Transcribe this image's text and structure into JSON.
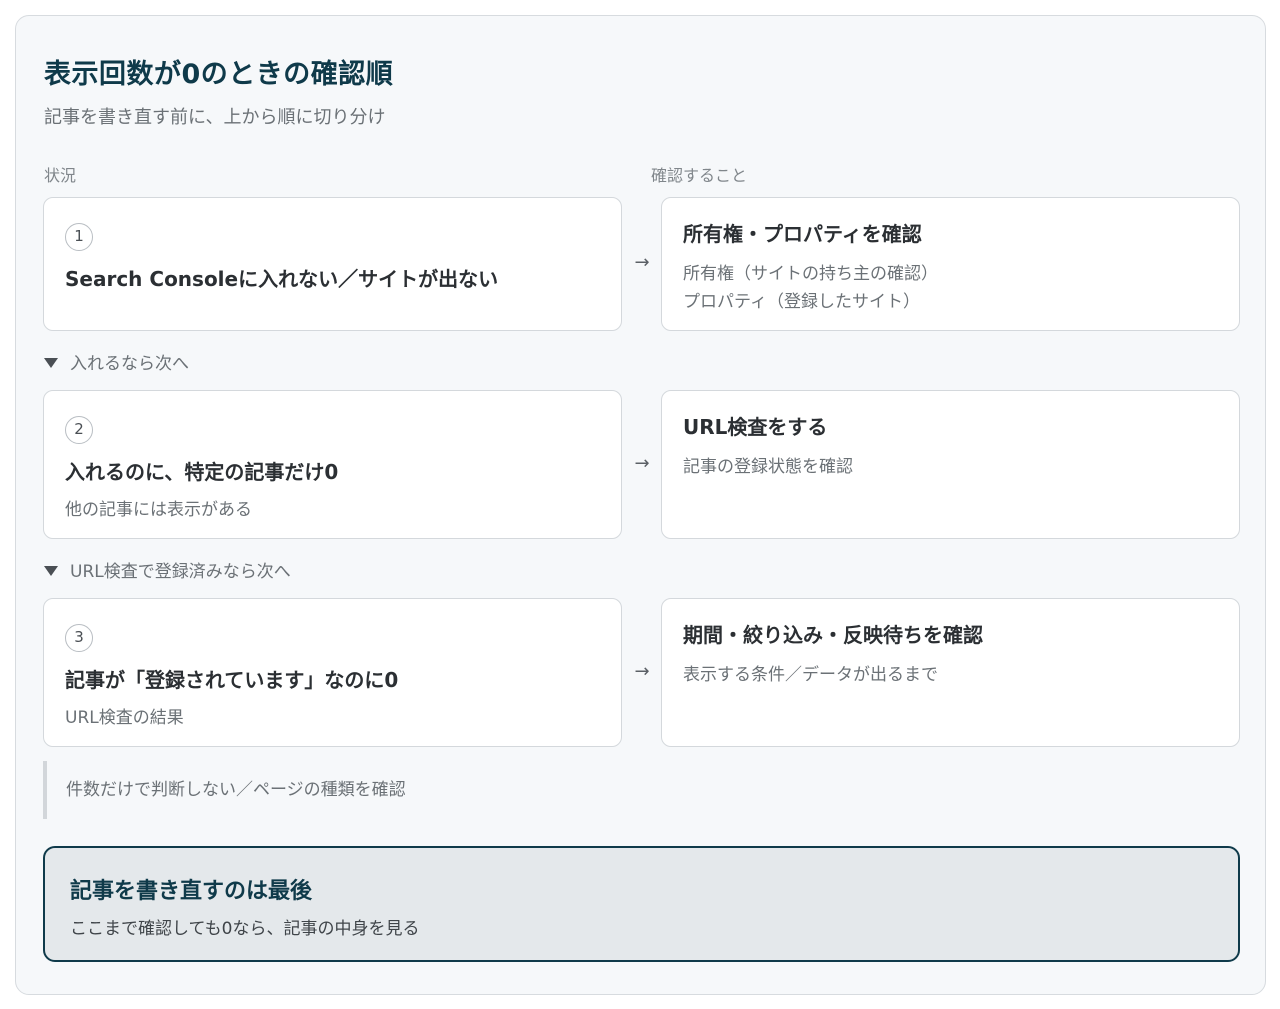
{
  "header": {
    "title": "表示回数が0のときの確認順",
    "subtitle": "記事を書き直す前に、上から順に切り分け"
  },
  "columns": {
    "left": "状況",
    "right": "確認すること"
  },
  "steps": [
    {
      "number": "1",
      "situation_title": "Search Consoleに入れない／サイトが出ない",
      "situation_sub": "",
      "check_title": "所有権・プロパティを確認",
      "check_lines": [
        "所有権（サイトの持ち主の確認）",
        "プロパティ（登録したサイト）"
      ]
    },
    {
      "number": "2",
      "situation_title": "入れるのに、特定の記事だけ0",
      "situation_sub": "他の記事には表示がある",
      "check_title": "URL検査をする",
      "check_lines": [
        "記事の登録状態を確認"
      ]
    },
    {
      "number": "3",
      "situation_title": "記事が「登録されています」なのに0",
      "situation_sub": "URL検査の結果",
      "check_title": "期間・絞り込み・反映待ちを確認",
      "check_lines": [
        "表示する条件／データが出るまで"
      ]
    }
  ],
  "connectors": [
    "入れるなら次へ",
    "URL検査で登録済みなら次へ"
  ],
  "arrow_glyph": "→",
  "note": "件数だけで判断しない／ページの種類を確認",
  "final": {
    "title": "記事を書き直すのは最後",
    "text": "ここまで確認しても0なら、記事の中身を見る"
  }
}
